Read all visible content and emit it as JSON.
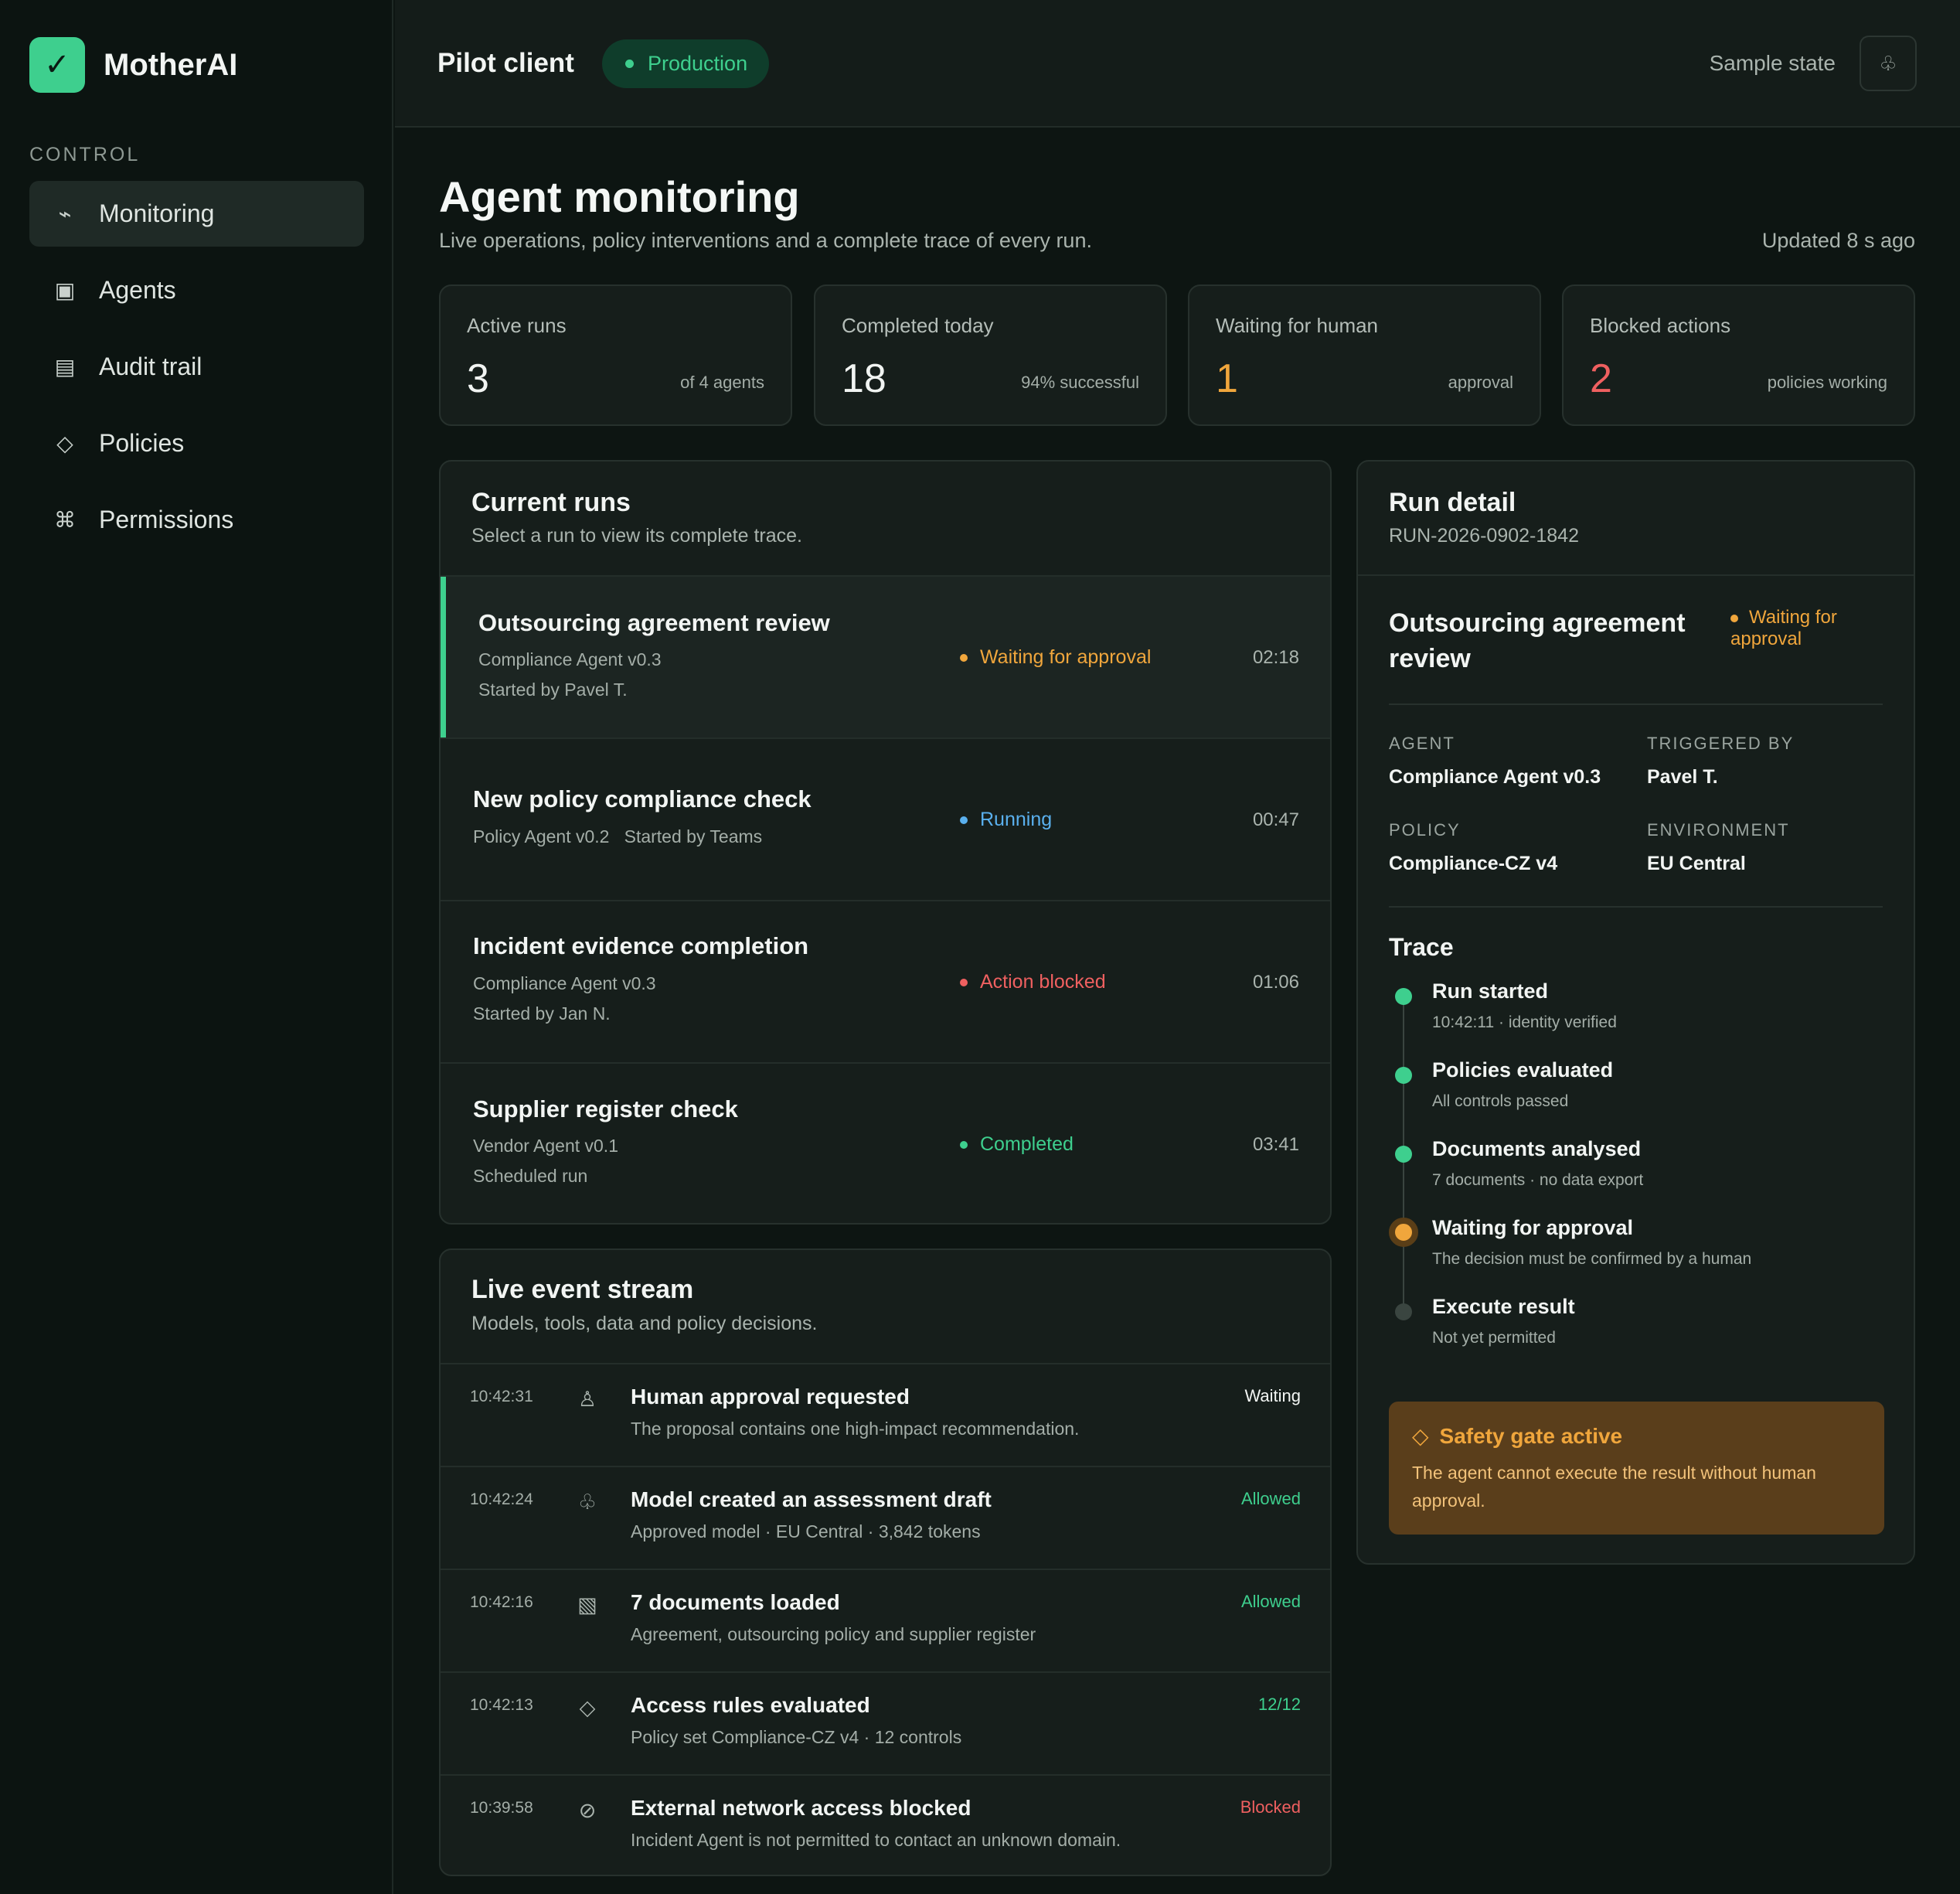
{
  "app": {
    "name": "MotherAI",
    "logo_icon": "check-icon"
  },
  "sidebar": {
    "section": "CONTROL",
    "items": [
      {
        "label": "Monitoring",
        "icon": "activity-icon",
        "active": true
      },
      {
        "label": "Agents",
        "icon": "agents-icon",
        "active": false
      },
      {
        "label": "Audit trail",
        "icon": "list-icon",
        "active": false
      },
      {
        "label": "Policies",
        "icon": "diamond-icon",
        "active": false
      },
      {
        "label": "Permissions",
        "icon": "command-icon",
        "active": false
      }
    ]
  },
  "topbar": {
    "client": "Pilot client",
    "environment": "Production",
    "sample_state": "Sample state",
    "settings_icon": "settings-icon"
  },
  "header": {
    "title": "Agent monitoring",
    "subtitle": "Live operations, policy interventions and a complete trace of every run.",
    "updated": "Updated 8 s ago"
  },
  "stats": [
    {
      "label": "Active runs",
      "value": "3",
      "note": "of 4 agents"
    },
    {
      "label": "Completed today",
      "value": "18",
      "note": "94% successful"
    },
    {
      "label": "Waiting for human",
      "value": "1",
      "note": "approval"
    },
    {
      "label": "Blocked actions",
      "value": "2",
      "note": "policies working"
    }
  ],
  "runs": {
    "title": "Current runs",
    "subtitle": "Select a run to view its complete trace.",
    "items": [
      {
        "title": "Outsourcing agreement review",
        "meta1": "Compliance Agent v0.3",
        "meta2": "Started by Pavel T.",
        "status": "Waiting for approval",
        "time": "02:18"
      },
      {
        "title": "New policy compliance check",
        "meta1": "Policy Agent v0.2   Started by Teams",
        "meta2": "",
        "status": "Running",
        "time": "00:47"
      },
      {
        "title": "Incident evidence completion",
        "meta1": "Compliance Agent v0.3",
        "meta2": "Started by Jan N.",
        "status": "Action blocked",
        "time": "01:06"
      },
      {
        "title": "Supplier register check",
        "meta1": "Vendor Agent v0.1",
        "meta2": "Scheduled run",
        "status": "Completed",
        "time": "03:41"
      }
    ]
  },
  "stream": {
    "title": "Live event stream",
    "subtitle": "Models, tools, data and policy decisions.",
    "events": [
      {
        "time": "10:42:31",
        "icon": "person-icon",
        "title": "Human approval requested",
        "desc": "The proposal contains one high-impact recommendation.",
        "tag": "Waiting"
      },
      {
        "time": "10:42:24",
        "icon": "model-icon",
        "title": "Model created an assessment draft",
        "desc": "Approved model · EU Central · 3,842 tokens",
        "tag": "Allowed"
      },
      {
        "time": "10:42:16",
        "icon": "documents-icon",
        "title": "7 documents loaded",
        "desc": "Agreement, outsourcing policy and supplier register",
        "tag": "Allowed"
      },
      {
        "time": "10:42:13",
        "icon": "diamond-icon",
        "title": "Access rules evaluated",
        "desc": "Policy set Compliance-CZ v4 · 12 controls",
        "tag": "12/12"
      },
      {
        "time": "10:39:58",
        "icon": "blocked-icon",
        "title": "External network access blocked",
        "desc": "Incident Agent is not permitted to contact an unknown domain.",
        "tag": "Blocked"
      }
    ]
  },
  "detail": {
    "title": "Run detail",
    "run_id": "RUN-2026-0902-1842",
    "run_title": "Outsourcing agreement review",
    "status": "Waiting for approval",
    "agent_label": "AGENT",
    "agent": "Compliance Agent v0.3",
    "triggered_label": "TRIGGERED BY",
    "triggered": "Pavel T.",
    "policy_label": "POLICY",
    "policy": "Compliance-CZ v4",
    "environment_label": "ENVIRONMENT",
    "environment": "EU Central",
    "trace_title": "Trace",
    "trace": [
      {
        "step": "Run started",
        "note": "10:42:11 · identity verified",
        "state": "done"
      },
      {
        "step": "Policies evaluated",
        "note": "All controls passed",
        "state": "done"
      },
      {
        "step": "Documents analysed",
        "note": "7 documents · no data export",
        "state": "done"
      },
      {
        "step": "Waiting for approval",
        "note": "The decision must be confirmed by a human",
        "state": "current"
      },
      {
        "step": "Execute result",
        "note": "Not yet permitted",
        "state": "pending"
      }
    ],
    "safety_title": "Safety gate active",
    "safety_text": "The agent cannot execute the result without human approval."
  },
  "colors": {
    "accent": "#3ecf8e",
    "warning": "#f0a63c",
    "danger": "#ef6060",
    "info": "#5ab0ee"
  }
}
